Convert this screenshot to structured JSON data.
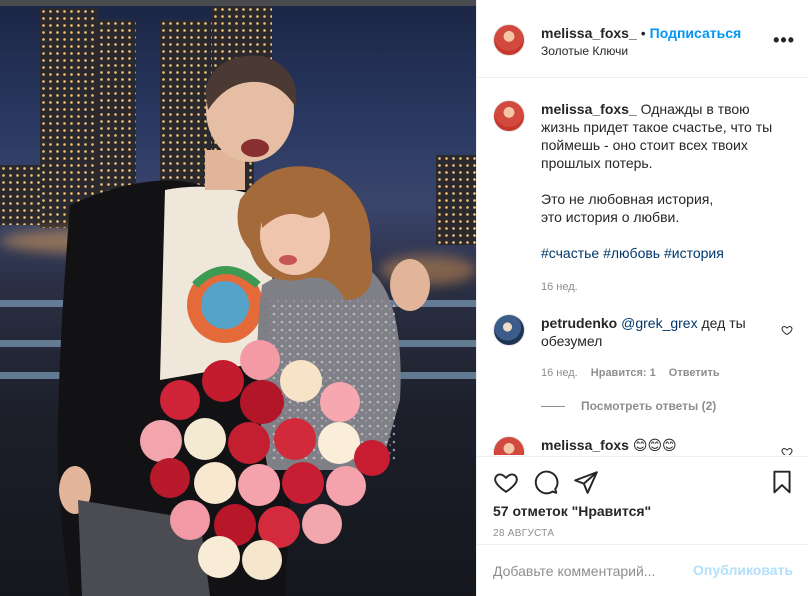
{
  "photo": {
    "alt": ""
  },
  "header": {
    "username": "melissa_foxs_",
    "separator": "•",
    "follow_label": "Подписаться",
    "location": "Золотые Ключи",
    "more_icon": "more-horizontal-icon"
  },
  "caption": {
    "username": "melissa_foxs_",
    "line1": "Однажды в твою жизнь придет такое счастье, что ты поймешь - оно стоит всех твоих прошлых потерь.",
    "line2": "Это не любовная история,",
    "line3": "это история о любви.",
    "tags": [
      "#счастье",
      "#любовь",
      "#история"
    ],
    "time": "16 нед."
  },
  "comments": [
    {
      "username": "petrudenko",
      "mention": "@grek_grex",
      "text": "дед ты обезумел",
      "time": "16 нед.",
      "likes": "Нравится: 1",
      "reply": "Ответить",
      "view_replies": "Посмотреть ответы (2)"
    },
    {
      "username": "melissa_foxs",
      "text": "😊😊😊"
    }
  ],
  "actions": {
    "like_icon": "heart-icon",
    "comment_icon": "comment-icon",
    "share_icon": "share-icon",
    "save_icon": "bookmark-icon",
    "likes": "57 отметок \"Нравится\"",
    "date": "28 АВГУСТА"
  },
  "add_comment": {
    "placeholder": "Добавьте комментарий...",
    "publish_label": "Опубликовать"
  },
  "colors": {
    "accent": "#0095f6",
    "publish_disabled": "#b2dffc",
    "muted": "#8e8e8e",
    "link": "#00376b"
  }
}
